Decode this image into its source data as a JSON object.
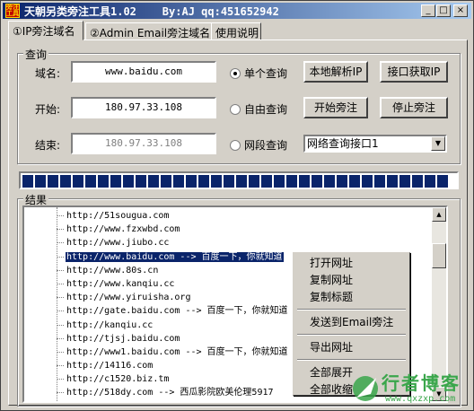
{
  "window": {
    "title": "天朝另类旁注工具1.02    By:AJ qq:451652942",
    "icon_text": "旁注工具",
    "minimize_glyph": "_",
    "maximize_glyph": "□",
    "close_glyph": "×"
  },
  "tabs": [
    {
      "label": "①IP旁注域名",
      "active": true
    },
    {
      "label": "②Admin Email旁注域名",
      "active": false
    },
    {
      "label": "使用说明",
      "active": false
    }
  ],
  "query": {
    "group_label": "查询",
    "domain_label": "域名:",
    "domain_value": "www.baidu.com",
    "start_label": "开始:",
    "start_value": "180.97.33.108",
    "end_label": "结束:",
    "end_value": "180.97.33.108",
    "radio_single": "单个查询",
    "radio_free": "自由查询",
    "radio_range": "网段查询",
    "btn_local_resolve": "本地解析IP",
    "btn_api_get": "接口获取IP",
    "btn_start": "开始旁注",
    "btn_stop": "停止旁注",
    "api_select_value": "网络查询接口1",
    "select_arrow": "▼"
  },
  "progress": {
    "fraction": 1.0
  },
  "results": {
    "group_label": "结果",
    "items": [
      "http://51sougua.com",
      "http://www.fzxwbd.com",
      "http://www.jiubo.cc",
      "http://www.baidu.com --> 百度一下，你就知道",
      "http://www.80s.cn",
      "http://www.kanqiu.cc",
      "http://www.yiruisha.org",
      "http://gate.baidu.com --> 百度一下，你就知道",
      "http://kanqiu.cc",
      "http://tjsj.baidu.com",
      "http://www1.baidu.com --> 百度一下，你就知道",
      "http://14116.com",
      "http://c1520.biz.tm",
      "http://518dy.com --> 西瓜影院欧美伦理5917"
    ],
    "selected_index": 3,
    "scroll_up": "▲",
    "scroll_down": "▼"
  },
  "context_menu": {
    "groups": [
      [
        "打开网址",
        "复制网址",
        "复制标题"
      ],
      [
        "发送到Email旁注"
      ],
      [
        "导出网址"
      ],
      [
        "全部展开",
        "全部收缩"
      ]
    ]
  },
  "watermark": {
    "text": "行者博客",
    "url": "www.qxzxp.com"
  }
}
